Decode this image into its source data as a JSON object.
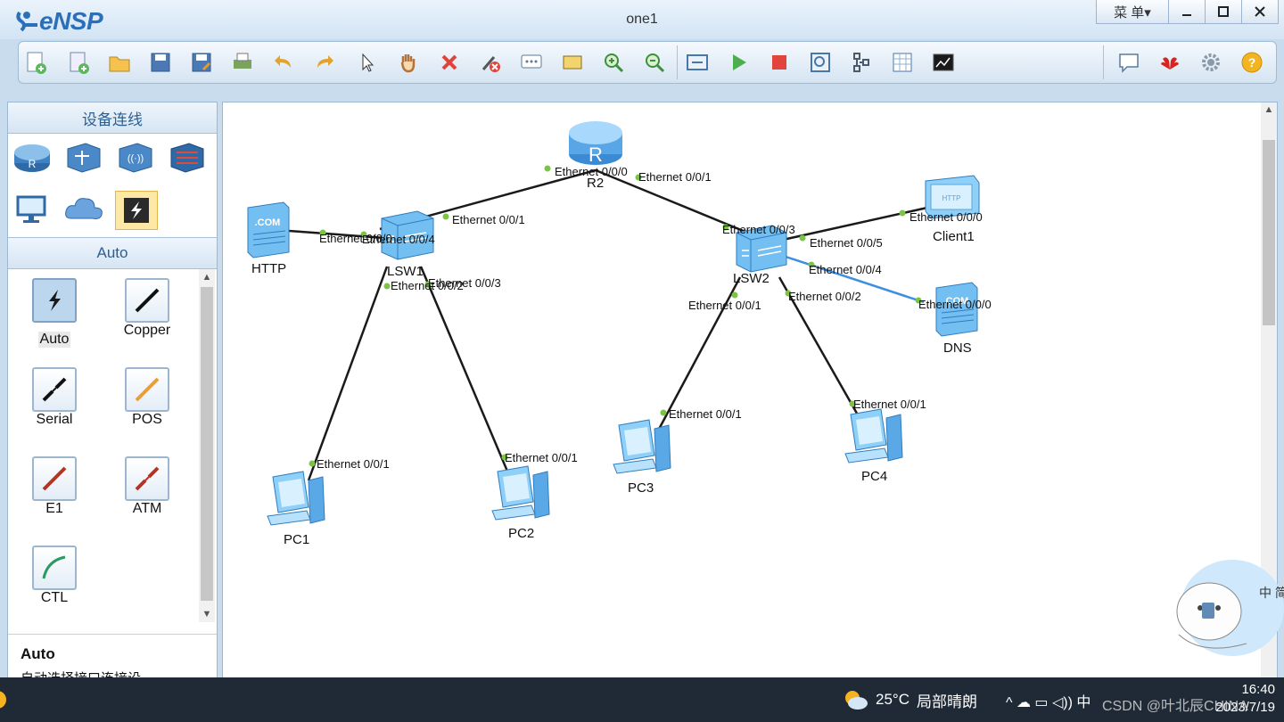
{
  "app": {
    "logo_text": "eNSP",
    "window_title": "one1",
    "menu_label": "菜 单▾"
  },
  "toolbar": {
    "icons": [
      "new-topology-icon",
      "new-example-icon",
      "open-icon",
      "save-icon",
      "save-as-icon",
      "print-icon",
      "undo-icon",
      "redo-icon",
      "select-pointer-icon",
      "pan-hand-icon",
      "delete-icon",
      "delete-all-links-icon",
      "text-annotation-icon",
      "rectangle-tool-icon",
      "zoom-in-icon",
      "zoom-out-icon",
      "fit-view-icon",
      "start-device-icon",
      "stop-device-icon",
      "capture-icon",
      "topology-icon",
      "grid-icon",
      "console-icon",
      "feedback-icon",
      "huawei-icon",
      "settings-icon",
      "help-icon"
    ]
  },
  "left_panel": {
    "title": "设备连线",
    "device_icons": [
      "router-icon",
      "switch-icon",
      "wireless-icon",
      "firewall-icon",
      "pc-terminal-icon",
      "cloud-icon",
      "auto-link-icon"
    ],
    "category_title": "Auto",
    "connections": [
      {
        "label": "Auto",
        "icon": "auto-link-icon",
        "selected": true
      },
      {
        "label": "Copper",
        "icon": "copper-link-icon",
        "selected": false
      },
      {
        "label": "Serial",
        "icon": "serial-link-icon",
        "selected": false
      },
      {
        "label": "POS",
        "icon": "pos-link-icon",
        "selected": false
      },
      {
        "label": "E1",
        "icon": "e1-link-icon",
        "selected": false
      },
      {
        "label": "ATM",
        "icon": "atm-link-icon",
        "selected": false
      },
      {
        "label": "CTL",
        "icon": "ctl-link-icon",
        "selected": false
      }
    ],
    "info_title": "Auto",
    "info_desc": "自动选择接口连接设"
  },
  "topology": {
    "devices": {
      "r2": "R2",
      "lsw1": "LSW1",
      "lsw2": "LSW2",
      "http": "HTTP",
      "client1": "Client1",
      "dns": "DNS",
      "pc1": "PC1",
      "pc2": "PC2",
      "pc3": "PC3",
      "pc4": "PC4"
    },
    "ports": {
      "r2_a": "Ethernet 0/0/0",
      "r2_b": "Ethernet 0/0/1",
      "lsw1_up": "Ethernet 0/0/1",
      "lsw1_http": "Ethernet 0/0/4",
      "http_port": "Ethernet 0/0/0",
      "lsw1_pc1": "Ethernet 0/0/2",
      "lsw1_pc2": "Ethernet 0/0/3",
      "pc1_port": "Ethernet 0/0/1",
      "pc2_port": "Ethernet 0/0/1",
      "lsw2_up": "Ethernet 0/0/3",
      "lsw2_client": "Ethernet 0/0/5",
      "client_port": "Ethernet 0/0/0",
      "lsw2_dns": "Ethernet 0/0/4",
      "dns_port": "Ethernet 0/0/0",
      "lsw2_pc3": "Ethernet 0/0/1",
      "lsw2_pc4": "Ethernet 0/0/2",
      "pc3_port": "Ethernet 0/0/1",
      "pc4_port": "Ethernet 0/0/1"
    }
  },
  "taskbar": {
    "weather_temp": "25°C",
    "weather_text": "局部晴朗",
    "tray_chars": "^ ☁ ▭ ◁)) 中",
    "time": "16:40",
    "date": "2023/7/19",
    "watermark": "CSDN @叶北辰CHINA",
    "ime_chars": "中 简"
  },
  "colors": {
    "accent": "#2a6fb8",
    "link": "#1a1a1a",
    "highlight_link": "#3d8fe0",
    "port_dot": "#7cc444"
  }
}
